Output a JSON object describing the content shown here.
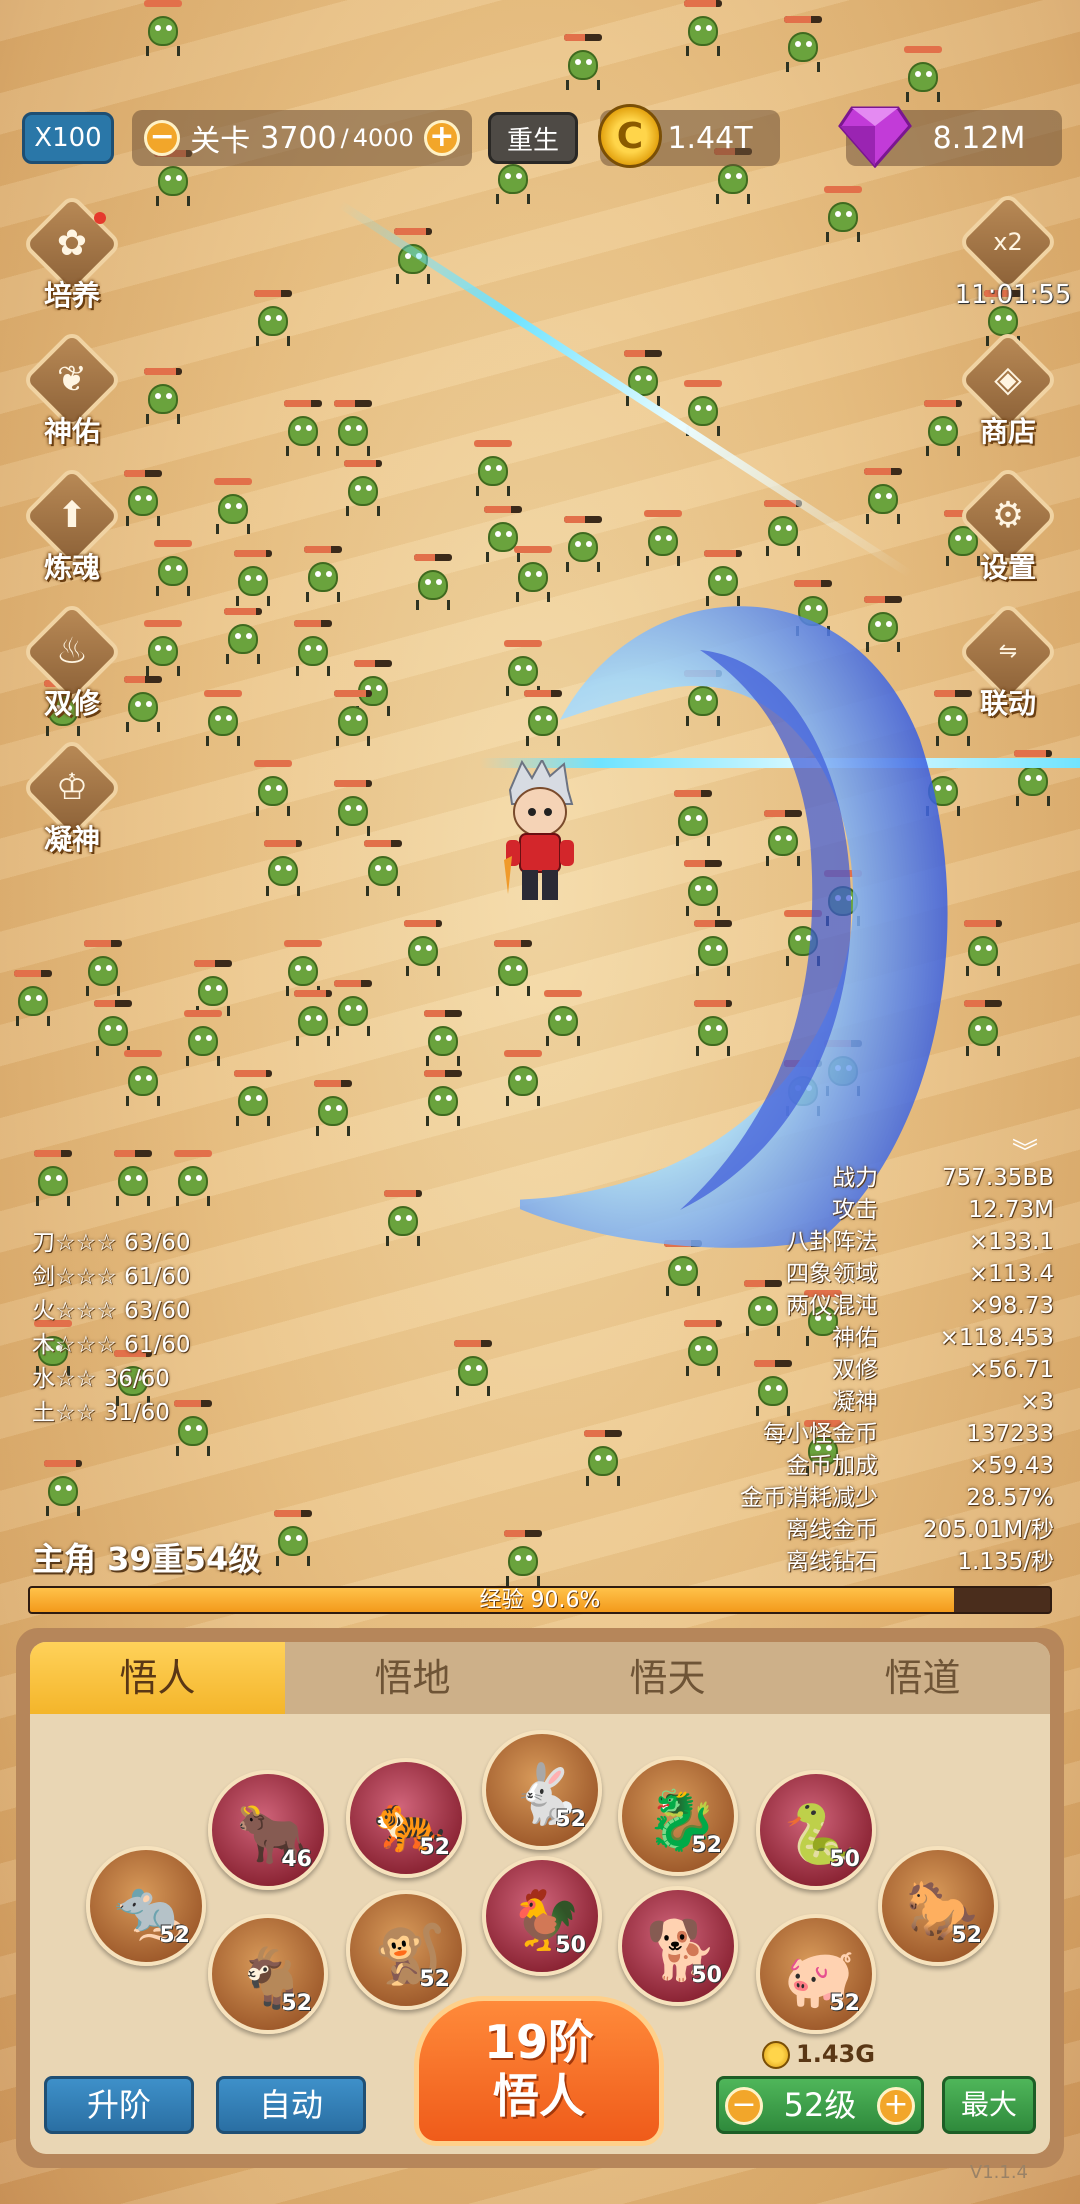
{
  "topbar": {
    "speed": "X100",
    "stage_label": "关卡",
    "stage_current": "3700",
    "stage_sep": "/",
    "stage_max": "4000",
    "rebirth": "重生",
    "gold": "1.44T",
    "gems": "8.12M"
  },
  "left_menu": [
    "培养",
    "神佑",
    "炼魂",
    "双修",
    "凝神"
  ],
  "right_menu": {
    "boost": "x2",
    "timer": "11:01:55",
    "shop": "商店",
    "settings": "设置",
    "linkage": "联动"
  },
  "stats": [
    {
      "label": "战力",
      "value": "757.35BB"
    },
    {
      "label": "攻击",
      "value": "12.73M"
    },
    {
      "label": "八卦阵法",
      "value": "×133.1"
    },
    {
      "label": "四象领域",
      "value": "×113.4"
    },
    {
      "label": "两仪混沌",
      "value": "×98.73"
    },
    {
      "label": "神佑",
      "value": "×118.453"
    },
    {
      "label": "双修",
      "value": "×56.71"
    },
    {
      "label": "凝神",
      "value": "×3"
    },
    {
      "label": "每小怪金币",
      "value": "137233"
    },
    {
      "label": "金币加成",
      "value": "×59.43"
    },
    {
      "label": "金币消耗减少",
      "value": "28.57%"
    },
    {
      "label": "离线金币",
      "value": "205.01M/秒"
    },
    {
      "label": "离线钻石",
      "value": "1.135/秒"
    }
  ],
  "elements": [
    {
      "name": "刀☆☆☆",
      "value": "63/60"
    },
    {
      "name": "剑☆☆☆",
      "value": "61/60"
    },
    {
      "name": "火☆☆☆",
      "value": "63/60"
    },
    {
      "name": "木☆☆☆",
      "value": "61/60"
    },
    {
      "name": "水☆☆",
      "value": "36/60"
    },
    {
      "name": "土☆☆",
      "value": "31/60"
    }
  ],
  "hero": {
    "level_text": "主角 39重54级",
    "exp_text": "经验 90.6%",
    "exp_fraction": 0.906
  },
  "tabs": [
    "悟人",
    "悟地",
    "悟天",
    "悟道"
  ],
  "zodiac": [
    {
      "icon": "ox-icon",
      "glyph": "🐂",
      "level": "46",
      "color": "red"
    },
    {
      "icon": "tiger-icon",
      "glyph": "🐅",
      "level": "52",
      "color": "red"
    },
    {
      "icon": "rabbit-icon",
      "glyph": "🐇",
      "level": "52",
      "color": "brown"
    },
    {
      "icon": "dragon-icon",
      "glyph": "🐉",
      "level": "52",
      "color": "brown"
    },
    {
      "icon": "snake-icon",
      "glyph": "🐍",
      "level": "50",
      "color": "red"
    },
    {
      "icon": "rat-icon",
      "glyph": "🐀",
      "level": "52",
      "color": "brown"
    },
    {
      "icon": "goat-icon",
      "glyph": "🐐",
      "level": "52",
      "color": "brown"
    },
    {
      "icon": "monkey-icon",
      "glyph": "🐒",
      "level": "52",
      "color": "brown"
    },
    {
      "icon": "rooster-icon",
      "glyph": "🐓",
      "level": "50",
      "color": "red"
    },
    {
      "icon": "dog-icon",
      "glyph": "🐕",
      "level": "50",
      "color": "red"
    },
    {
      "icon": "pig-icon",
      "glyph": "🐖",
      "level": "52",
      "color": "brown"
    },
    {
      "icon": "horse-icon",
      "glyph": "🐎",
      "level": "52",
      "color": "brown"
    }
  ],
  "actions": {
    "upgrade": "升阶",
    "auto": "自动",
    "rank_line1": "19阶",
    "rank_line2": "悟人",
    "cost": "1.43G",
    "level": "52级",
    "max": "最大"
  },
  "version": "V1.1.4"
}
